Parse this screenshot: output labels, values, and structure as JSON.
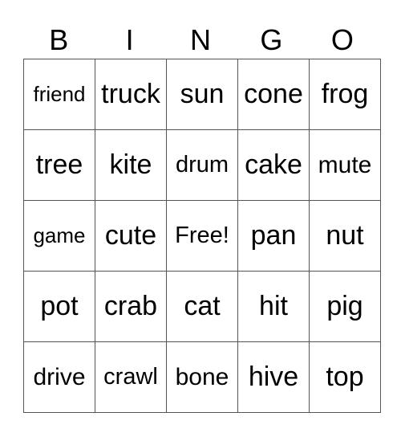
{
  "header": [
    "B",
    "I",
    "N",
    "G",
    "O"
  ],
  "rows": [
    [
      "friend",
      "truck",
      "sun",
      "cone",
      "frog"
    ],
    [
      "tree",
      "kite",
      "drum",
      "cake",
      "mute"
    ],
    [
      "game",
      "cute",
      "Free!",
      "pan",
      "nut"
    ],
    [
      "pot",
      "crab",
      "cat",
      "hit",
      "pig"
    ],
    [
      "drive",
      "crawl",
      "bone",
      "hive",
      "top"
    ]
  ]
}
